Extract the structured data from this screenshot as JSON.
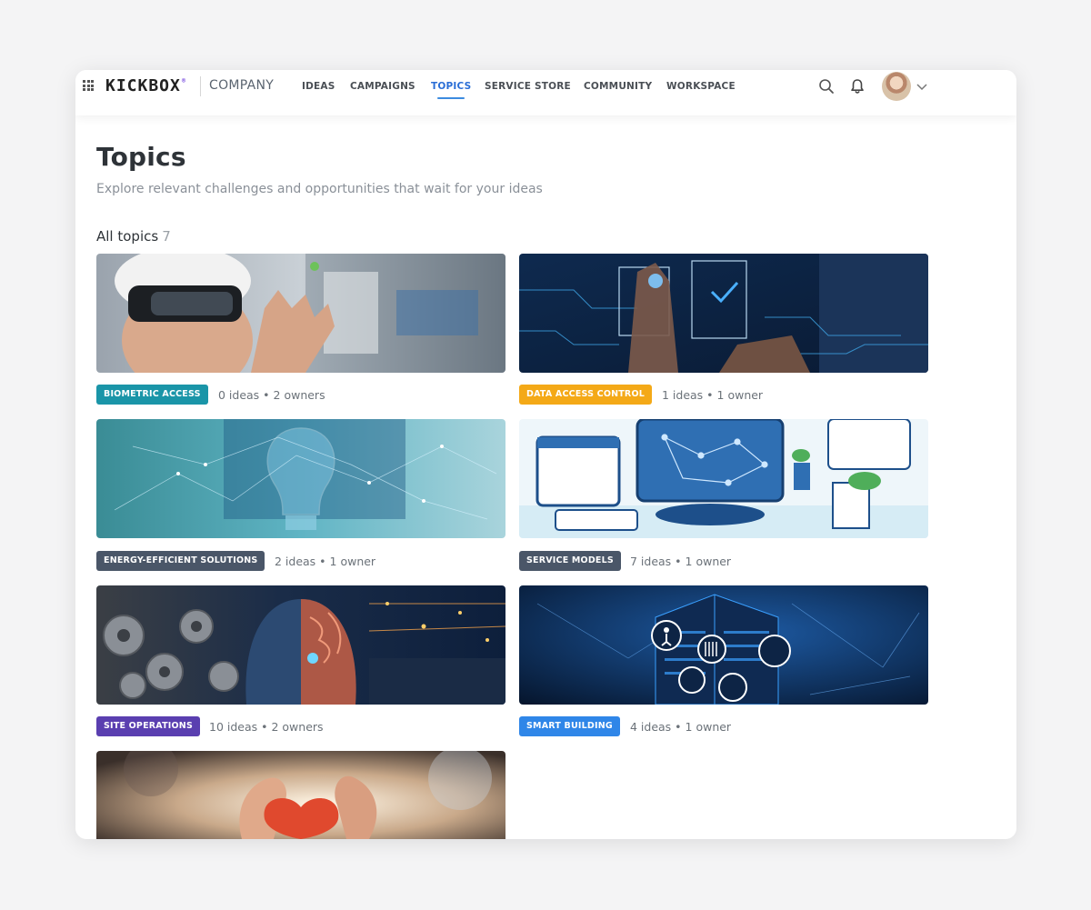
{
  "app": {
    "brand": "KICKBOX",
    "brand_mark": "®",
    "company": "COMPANY"
  },
  "nav": {
    "items": [
      {
        "label": "IDEAS",
        "active": false
      },
      {
        "label": "CAMPAIGNS",
        "active": false
      },
      {
        "label": "TOPICS",
        "active": true
      },
      {
        "label": "SERVICE STORE",
        "active": false
      },
      {
        "label": "COMMUNITY",
        "active": false
      },
      {
        "label": "WORKSPACE",
        "active": false
      }
    ],
    "icons": [
      "apps-grid-icon",
      "search-icon",
      "bell-icon",
      "chevron-down-icon"
    ]
  },
  "page": {
    "title": "Topics",
    "subtitle": "Explore relevant challenges and opportunities that wait for your ideas",
    "section_label": "All topics",
    "section_count": "7"
  },
  "topics": [
    {
      "tag": "BIOMETRIC ACCESS",
      "meta": "0 ideas • 2 owners",
      "tag_color": "#1a95a8"
    },
    {
      "tag": "DATA ACCESS CONTROL",
      "meta": "1 ideas • 1 owner",
      "tag_color": "#f4a917"
    },
    {
      "tag": "ENERGY-EFFICIENT SOLUTIONS",
      "meta": "2 ideas • 1 owner",
      "tag_color": "#4a5668"
    },
    {
      "tag": "SERVICE MODELS",
      "meta": "7 ideas • 1 owner",
      "tag_color": "#4a5668"
    },
    {
      "tag": "SITE OPERATIONS",
      "meta": "10 ideas • 2 owners",
      "tag_color": "#5a3fb0"
    },
    {
      "tag": "SMART BUILDING",
      "meta": "4 ideas • 1 owner",
      "tag_color": "#2f86e8"
    }
  ],
  "theme": {
    "accent": "#2a6ed6",
    "page_bg": "#f4f4f5"
  }
}
